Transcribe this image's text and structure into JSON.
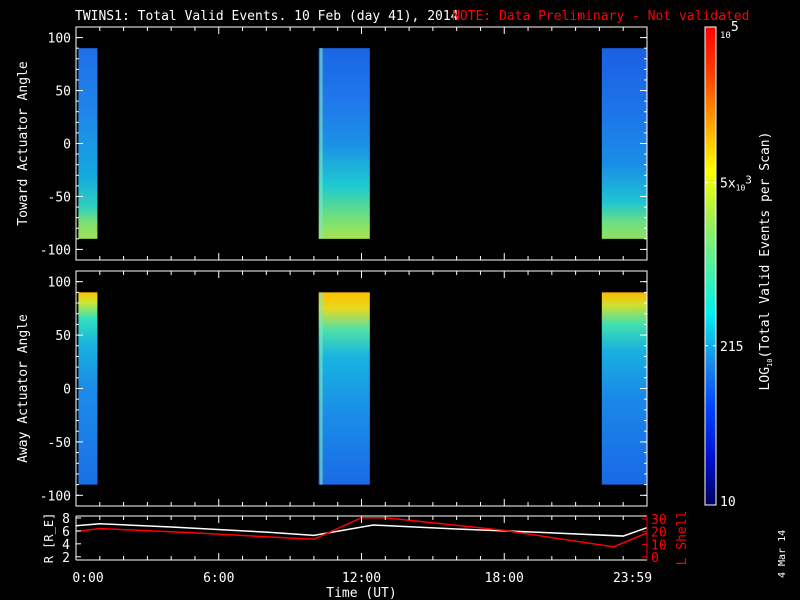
{
  "chart_data": [
    {
      "type": "heatmap",
      "title": "TWINS1: Total Valid Events. 10 Feb (day  41), 2014",
      "note": "NOTE: Data Preliminary - Not validated",
      "ylabel": "Toward Actuator Angle",
      "ylim": [
        -110,
        110
      ],
      "yticks": [
        "100",
        "50",
        "0",
        "-50",
        "-100"
      ],
      "ytick_values": [
        100,
        50,
        0,
        -50,
        -100
      ],
      "xlim_hours": [
        0,
        24
      ],
      "data_range_deg": [
        -90,
        90
      ],
      "blocks": [
        {
          "t0": 0.1,
          "t1": 0.9,
          "stops": [
            [
              90,
              "#1f6fe8"
            ],
            [
              30,
              "#1f86ea"
            ],
            [
              -30,
              "#14a8e0"
            ],
            [
              -60,
              "#2fd0c0"
            ],
            [
              -75,
              "#7ee070"
            ],
            [
              -90,
              "#9ee25a"
            ]
          ]
        },
        {
          "t0": 10.2,
          "t1": 12.35,
          "stops": [
            [
              90,
              "#1a66e6"
            ],
            [
              40,
              "#1f78ea"
            ],
            [
              0,
              "#1c90e6"
            ],
            [
              -40,
              "#1ecad0"
            ],
            [
              -70,
              "#70e07a"
            ],
            [
              -90,
              "#a8e450"
            ]
          ]
        },
        {
          "t0": 22.1,
          "t1": 24,
          "stops": [
            [
              90,
              "#1a60e4"
            ],
            [
              30,
              "#1d74e8"
            ],
            [
              -20,
              "#1a8ee6"
            ],
            [
              -55,
              "#1ec4d4"
            ],
            [
              -75,
              "#6ee080"
            ],
            [
              -90,
              "#90e060"
            ]
          ]
        }
      ]
    },
    {
      "type": "heatmap",
      "ylabel": "Away Actuator Angle",
      "ylim": [
        -110,
        110
      ],
      "yticks": [
        "100",
        "50",
        "0",
        "-50",
        "-100"
      ],
      "ytick_values": [
        100,
        50,
        0,
        -50,
        -100
      ],
      "xlim_hours": [
        0,
        24
      ],
      "blocks": [
        {
          "t0": 0.1,
          "t1": 0.9,
          "stops": [
            [
              90,
              "#ffc400"
            ],
            [
              80,
              "#c8e838"
            ],
            [
              65,
              "#30e0c0"
            ],
            [
              40,
              "#18b0e0"
            ],
            [
              0,
              "#1c8ce8"
            ],
            [
              -90,
              "#1a70e6"
            ]
          ]
        },
        {
          "t0": 10.2,
          "t1": 12.35,
          "stops": [
            [
              90,
              "#ffc000"
            ],
            [
              75,
              "#e8d820"
            ],
            [
              55,
              "#50e0a8"
            ],
            [
              30,
              "#18b4e0"
            ],
            [
              -20,
              "#1a90e8"
            ],
            [
              -90,
              "#1a6ae6"
            ]
          ]
        },
        {
          "t0": 22.1,
          "t1": 24,
          "stops": [
            [
              90,
              "#ffb800"
            ],
            [
              78,
              "#d0e030"
            ],
            [
              60,
              "#40e0b0"
            ],
            [
              35,
              "#18b0e0"
            ],
            [
              -10,
              "#1a88e8"
            ],
            [
              -90,
              "#1a68e6"
            ]
          ]
        }
      ]
    },
    {
      "type": "line",
      "xlabel": "Time (UT)",
      "xticks": [
        "0:00",
        "6:00",
        "12:00",
        "18:00",
        "23:59"
      ],
      "xtick_hours": [
        0,
        6,
        12,
        18,
        23.98
      ],
      "xlim": [
        0,
        24
      ],
      "ylabel": "R [R_E]",
      "ylabel_main": "R [R",
      "ylabel_sub": "E",
      "ylabel_end": "]",
      "ylim": [
        1.5,
        8.3
      ],
      "yticks": [
        "8",
        "6",
        "4",
        "2"
      ],
      "ytick_values": [
        8,
        6,
        4,
        2
      ],
      "y2label": "L Shell",
      "y2lim": [
        0,
        30
      ],
      "y2ticks": [
        "30",
        "20",
        "10",
        "0"
      ],
      "y2tick_values": [
        30,
        20,
        10,
        0
      ],
      "series": [
        {
          "name": "R",
          "color": "#ffffff",
          "axis": "left",
          "x": [
            0,
            1,
            4,
            8,
            10,
            12.5,
            16,
            20,
            23,
            24
          ],
          "y": [
            6.8,
            7.1,
            6.6,
            5.8,
            5.3,
            6.9,
            6.3,
            5.7,
            5.2,
            6.5
          ]
        },
        {
          "name": "L Shell",
          "color": "#ff0000",
          "axis": "right",
          "x": [
            0,
            1,
            5,
            10,
            12,
            13,
            18,
            22.6,
            24
          ],
          "y": [
            20,
            22.5,
            19,
            14,
            31,
            31,
            21,
            8,
            19
          ]
        }
      ]
    }
  ],
  "colorbar": {
    "label_main": "LOG",
    "label_sub": "10",
    "label_end": "(Total Valid  Events per Scan)",
    "ticks": [
      {
        "label": "10",
        "sup": "5",
        "prefix": "",
        "value": 100000
      },
      {
        "label": "3",
        "prefix": "5x",
        "sub": "10",
        "value": 5000
      },
      {
        "label": "215",
        "value": 215
      },
      {
        "label": "10",
        "value": 10
      }
    ],
    "colors": [
      "#000060",
      "#0010d0",
      "#0040ff",
      "#1a8ce8",
      "#00f0f0",
      "#50f0a0",
      "#a0f050",
      "#ffff00",
      "#ffa000",
      "#ff4000",
      "#ff0000"
    ]
  },
  "footer_date": "4 Mar 14"
}
